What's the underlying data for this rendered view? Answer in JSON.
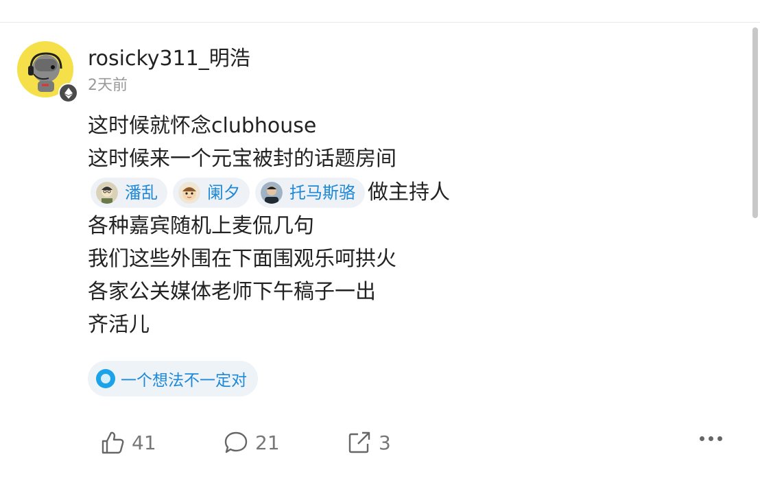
{
  "post": {
    "username": "rosicky311_明浩",
    "time": "2天前",
    "lines": [
      "这时候就怀念clubhouse",
      "这时候来一个元宝被封的话题房间"
    ],
    "mentions": [
      {
        "name": "潘乱"
      },
      {
        "name": "阑夕"
      },
      {
        "name": "托马斯骆"
      }
    ],
    "mention_suffix": "做主持人",
    "lines_after": [
      "各种嘉宾随机上麦侃几句",
      "我们这些外围在下面围观乐呵拱火",
      "各家公关媒体老师下午稿子一出",
      "齐活儿"
    ],
    "topic": "一个想法不一定对"
  },
  "actions": {
    "likes": "41",
    "comments": "21",
    "shares": "3"
  },
  "colors": {
    "link": "#1e88d8",
    "text": "#222222",
    "muted": "#999999"
  },
  "icons": {
    "like": "thumbs-up-icon",
    "comment": "comment-bubble-icon",
    "share": "share-icon",
    "more": "more-dots-icon",
    "badge": "ethereum-badge-icon",
    "topic": "topic-circle-icon"
  }
}
